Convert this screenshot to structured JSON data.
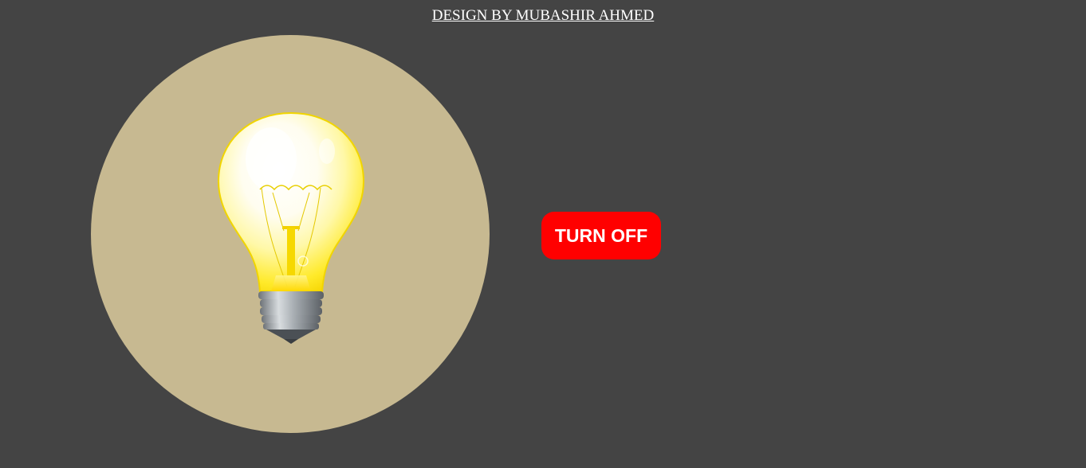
{
  "header": {
    "credit_text": "DESIGN BY MUBASHIR AHMED"
  },
  "bulb": {
    "state": "on",
    "icon": "lightbulb-icon",
    "circle_color": "#c7b991"
  },
  "toggle": {
    "label": "TURN OFF",
    "color": "#ff0000"
  },
  "colors": {
    "background": "#444444"
  }
}
